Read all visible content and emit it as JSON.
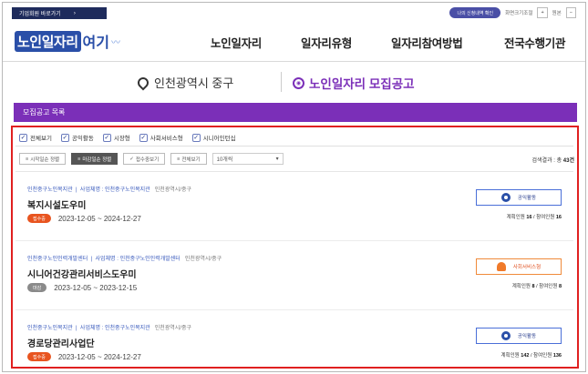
{
  "topbar": {
    "skip_label": "기업회원 바로가기",
    "skip_arrow": "›",
    "pill_label": "나의 신청내역 확인",
    "util_text": "화면크기조절",
    "plus": "+",
    "reset": "원본",
    "minus": "−"
  },
  "header": {
    "logo_part1": "노인일자리",
    "logo_part2": "여기",
    "logo_part3": "〰",
    "nav": [
      "노인일자리",
      "일자리유형",
      "일자리참여방법",
      "전국수행기관"
    ]
  },
  "location": {
    "region": "인천광역시 중구",
    "title": "노인일자리 모집공고"
  },
  "banner": {
    "label": "모집공고 목록"
  },
  "filters": [
    {
      "label": "전체보기",
      "checked": true
    },
    {
      "label": "공익활동",
      "checked": true
    },
    {
      "label": "시장형",
      "checked": true
    },
    {
      "label": "사회서비스형",
      "checked": true
    },
    {
      "label": "시니어인턴십",
      "checked": true
    }
  ],
  "sort": {
    "buttons": [
      {
        "label": "시작일순 정렬",
        "icon": "≡",
        "active": false
      },
      {
        "label": "마감일순 정렬",
        "icon": "≡",
        "active": true
      },
      {
        "label": "접수중보기",
        "icon": "✓",
        "active": false
      },
      {
        "label": "전체보기",
        "icon": "≡",
        "active": false
      }
    ],
    "count_select": "10개씩",
    "count_arrow": "▾",
    "result_prefix": "검색결과 : 총 ",
    "result_value": "43건"
  },
  "cards": [
    {
      "agency": "인천중구노인복지관",
      "org_prefix": "사업체명 : 인천중구노인복지관",
      "region": "인천광역시/중구",
      "title": "복지시설도우미",
      "status": "접수중",
      "dates": "2023-12-05 ~ 2024-12-27",
      "type": "공익활동",
      "planned_label": "계획인원 ",
      "planned": "16",
      "joined_label": " / 참여인원 ",
      "joined": "16"
    },
    {
      "agency": "인천중구노인인력개발센터",
      "org_prefix": "사업체명 : 인천중구노인인력개발센터",
      "region": "인천광역시/중구",
      "title": "시니어건강관리서비스도우미",
      "status": "마감",
      "dates": "2023-12-05 ~ 2023-12-15",
      "type": "사회서비스형",
      "planned_label": "계획인원 ",
      "planned": "8",
      "joined_label": " / 참여인원 ",
      "joined": "8"
    },
    {
      "agency": "인천중구노인복지관",
      "org_prefix": "사업체명 : 인천중구노인복지관",
      "region": "인천광역시/중구",
      "title": "경로당관리사업단",
      "status": "접수중",
      "dates": "2023-12-05 ~ 2024-12-27",
      "type": "공익활동",
      "planned_label": "계획인원 ",
      "planned": "142",
      "joined_label": " / 참여인원 ",
      "joined": "136"
    }
  ],
  "colors": {
    "brand_blue": "#2a4fa8",
    "purple": "#7b2fb8",
    "highlight_red": "#e02020",
    "status_open": "#e8541f",
    "status_closed": "#8a8a8a"
  }
}
